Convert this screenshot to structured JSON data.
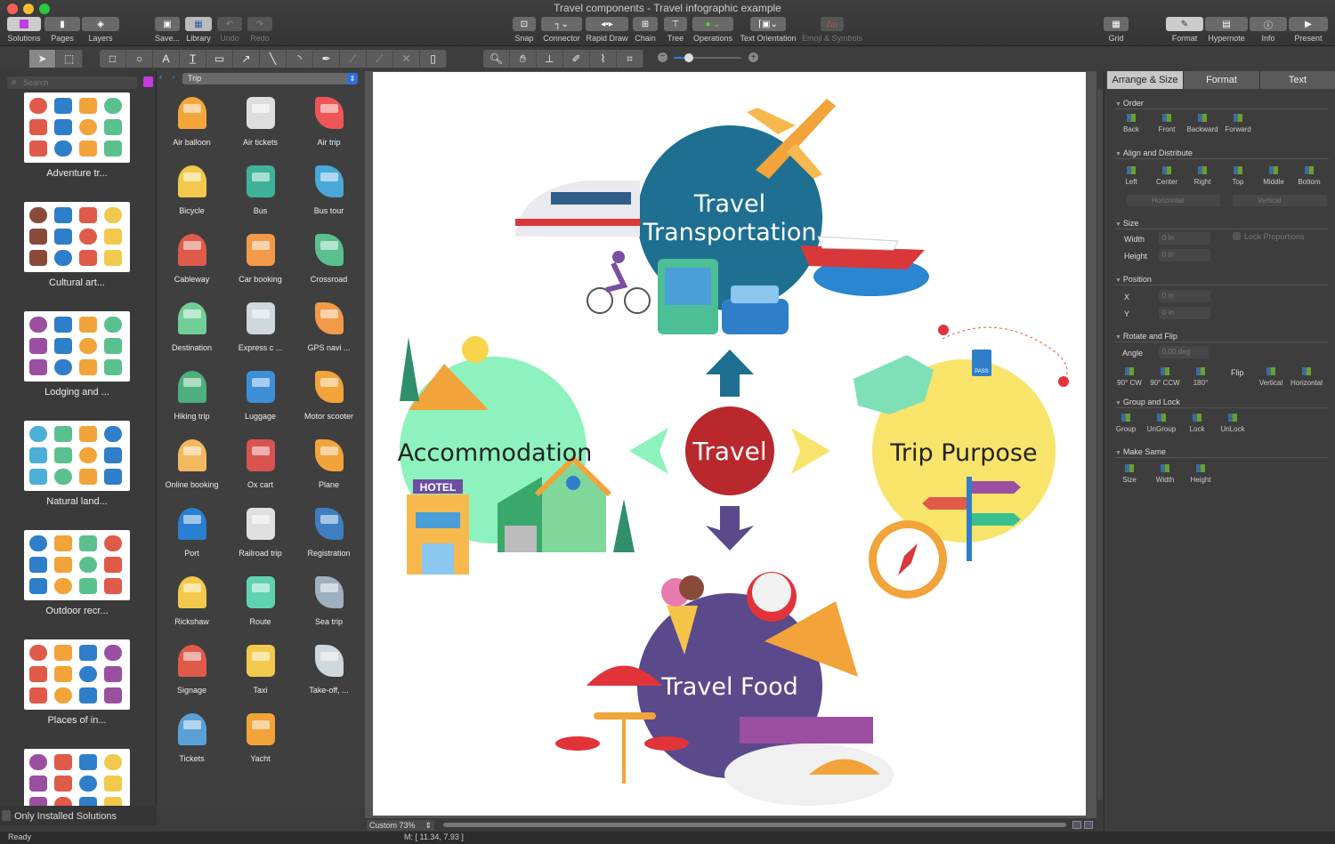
{
  "window": {
    "title": "Travel components - Travel infographic example"
  },
  "toolbar": {
    "left": [
      {
        "label": "Solutions"
      },
      {
        "label": "Pages"
      },
      {
        "label": "Layers"
      }
    ],
    "file": [
      {
        "label": "Save..."
      },
      {
        "label": "Library"
      },
      {
        "label": "Undo"
      },
      {
        "label": "Redo"
      }
    ],
    "center": [
      {
        "label": "Snap"
      },
      {
        "label": "Connector"
      },
      {
        "label": "Rapid Draw"
      },
      {
        "label": "Chain"
      },
      {
        "label": "Tree"
      },
      {
        "label": "Operations"
      },
      {
        "label": "Text Orientation"
      },
      {
        "label": "Emoji & Symbols"
      }
    ],
    "grid": "Grid",
    "right": [
      {
        "label": "Format"
      },
      {
        "label": "Hypernote"
      },
      {
        "label": "Info"
      },
      {
        "label": "Present"
      }
    ]
  },
  "sidebar": {
    "search_placeholder": "Search",
    "solutions": [
      {
        "label": "Adventure tr..."
      },
      {
        "label": "Cultural art..."
      },
      {
        "label": "Lodging and ..."
      },
      {
        "label": "Natural land..."
      },
      {
        "label": "Outdoor recr..."
      },
      {
        "label": "Places of in..."
      },
      {
        "label": ""
      }
    ],
    "only_installed": "Only Installed Solutions"
  },
  "library": {
    "selected": "Trip",
    "items": [
      {
        "label": "Air balloon",
        "color": "#f4a63a"
      },
      {
        "label": "Air tickets",
        "color": "#ddd"
      },
      {
        "label": "Air trip",
        "color": "#e55"
      },
      {
        "label": "Bicycle",
        "color": "#f2c94c"
      },
      {
        "label": "Bus",
        "color": "#3fb39a"
      },
      {
        "label": "Bus tour",
        "color": "#4aa8d8"
      },
      {
        "label": "Cableway",
        "color": "#e05a4a"
      },
      {
        "label": "Car booking",
        "color": "#f2994a"
      },
      {
        "label": "Crossroad",
        "color": "#5ac18e"
      },
      {
        "label": "Destination",
        "color": "#6fcf97"
      },
      {
        "label": "Express c ...",
        "color": "#cfd8dc"
      },
      {
        "label": "GPS navi ...",
        "color": "#f2994a"
      },
      {
        "label": "Hiking trip",
        "color": "#4caf7d"
      },
      {
        "label": "Luggage",
        "color": "#3d8fd8"
      },
      {
        "label": "Motor scooter",
        "color": "#f2a33a"
      },
      {
        "label": "Online booking",
        "color": "#f4b860"
      },
      {
        "label": "Ox cart",
        "color": "#d9534f"
      },
      {
        "label": "Plane",
        "color": "#f2a33a"
      },
      {
        "label": "Port",
        "color": "#2a7fd0"
      },
      {
        "label": "Railroad trip",
        "color": "#e0e0e0"
      },
      {
        "label": "Registration",
        "color": "#3d7fc0"
      },
      {
        "label": "Rickshaw",
        "color": "#f2c94c"
      },
      {
        "label": "Route",
        "color": "#5fd3b0"
      },
      {
        "label": "Sea trip",
        "color": "#9fb0c0"
      },
      {
        "label": "Signage",
        "color": "#e05a4a"
      },
      {
        "label": "Taxi",
        "color": "#f2c94c"
      },
      {
        "label": "Take-off, ...",
        "color": "#cfd8dc"
      },
      {
        "label": "Tickets",
        "color": "#5aa0d8"
      },
      {
        "label": "Yacht",
        "color": "#f2a33a"
      }
    ]
  },
  "canvas": {
    "zoom": "Custom 73%",
    "center_label": "Travel",
    "topics": {
      "transport": {
        "line1": "Travel",
        "line2": "Transportation",
        "color": "#1e6f92"
      },
      "accommodation": {
        "label": "Accommodation",
        "color": "#8df2bd"
      },
      "purpose": {
        "label": "Trip Purpose",
        "color": "#f8e46a"
      },
      "food": {
        "label": "Travel Food",
        "color": "#5a4a8c"
      }
    },
    "hotel_sign": "HOTEL",
    "pass_label": "PASS",
    "center_color": "#b8282d"
  },
  "status": {
    "text": "Ready",
    "mouse": "M: [ 11.34, 7.93 ]"
  },
  "panel": {
    "tabs": [
      {
        "label": "Arrange & Size"
      },
      {
        "label": "Format"
      },
      {
        "label": "Text"
      }
    ],
    "order": {
      "title": "Order",
      "buttons": [
        {
          "label": "Back"
        },
        {
          "label": "Front"
        },
        {
          "label": "Backward"
        },
        {
          "label": "Forward"
        }
      ]
    },
    "align": {
      "title": "Align and Distribute",
      "buttons": [
        {
          "label": "Left"
        },
        {
          "label": "Center"
        },
        {
          "label": "Right"
        },
        {
          "label": "Top"
        },
        {
          "label": "Middle"
        },
        {
          "label": "Bottom"
        }
      ],
      "horizontal": "Horizontal",
      "vertical": "Vertical"
    },
    "size": {
      "title": "Size",
      "width_label": "Width",
      "width": "0 in",
      "height_label": "Height",
      "height": "0 in",
      "lock": "Lock Proportions"
    },
    "position": {
      "title": "Position",
      "x_label": "X",
      "x": "0 in",
      "y_label": "Y",
      "y": "0 in"
    },
    "rotate": {
      "title": "Rotate and Flip",
      "angle_label": "Angle",
      "angle": "0.00 deg",
      "buttons": [
        {
          "label": "90° CW"
        },
        {
          "label": "90° CCW"
        },
        {
          "label": "180°"
        }
      ],
      "flip": "Flip",
      "flip_buttons": [
        {
          "label": "Vertical"
        },
        {
          "label": "Horizontal"
        }
      ]
    },
    "group": {
      "title": "Group and Lock",
      "buttons": [
        {
          "label": "Group"
        },
        {
          "label": "UnGroup"
        },
        {
          "label": "Lock"
        },
        {
          "label": "UnLock"
        }
      ]
    },
    "same": {
      "title": "Make Same",
      "buttons": [
        {
          "label": "Size"
        },
        {
          "label": "Width"
        },
        {
          "label": "Height"
        }
      ]
    }
  }
}
